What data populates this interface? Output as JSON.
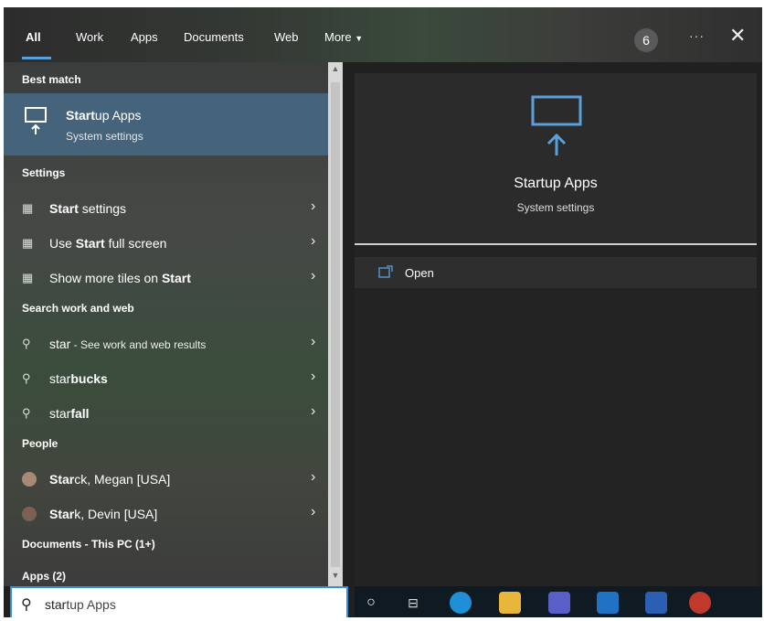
{
  "tabs": [
    {
      "label": "All",
      "active": true
    },
    {
      "label": "Work"
    },
    {
      "label": "Apps"
    },
    {
      "label": "Documents"
    },
    {
      "label": "Web"
    },
    {
      "label": "More"
    }
  ],
  "header": {
    "badge_count": "6",
    "more_icon": "ellipsis-icon",
    "close_icon": "close-icon"
  },
  "sections": {
    "best_match": "Best match",
    "settings": "Settings",
    "search_web": "Search work and web",
    "people": "People",
    "documents": "Documents - This PC (1+)",
    "apps": "Apps (2)"
  },
  "best_match": {
    "title_bold": "Start",
    "title_rest": "up Apps",
    "subtitle": "System settings"
  },
  "settings_items": [
    {
      "bold": "Start",
      "rest": " settings"
    },
    {
      "pre": "Use ",
      "bold": "Start",
      "rest": " full screen"
    },
    {
      "pre": "Show more tiles on ",
      "bold": "Start",
      "rest": ""
    }
  ],
  "web_items": [
    {
      "pre": "star",
      "rest": " - See work and web results"
    },
    {
      "pre": "star",
      "bold": "bucks"
    },
    {
      "pre": "star",
      "bold": "fall"
    }
  ],
  "people_items": [
    {
      "bold": "Star",
      "rest": "ck, Megan [USA]"
    },
    {
      "bold": "Star",
      "rest": "k, Devin [USA]"
    }
  ],
  "preview": {
    "title": "Startup Apps",
    "subtitle": "System settings",
    "open_label": "Open"
  },
  "search": {
    "typed": "star",
    "rest": "tup Apps"
  },
  "colors": {
    "accent": "#5aa0dc",
    "selected_bg": "#46637c"
  }
}
